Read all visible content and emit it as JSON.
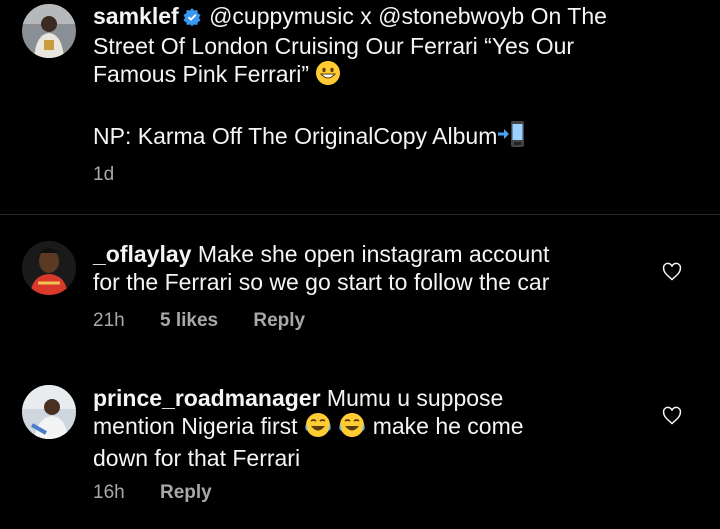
{
  "post": {
    "username": "samklef",
    "caption_line1": "@cuppymusic x @stonebwoyb On The",
    "caption_line2": "Street Of London Cruising Our Ferrari “Yes Our",
    "caption_line3": "Famous Pink Ferrari”",
    "caption_line4": "NP: Karma Off The OriginalCopy Album",
    "time": "1d",
    "emoji_1": "grin-emoji",
    "emoji_2": "phone-arrow-emoji"
  },
  "comments": [
    {
      "username": "_oflaylay",
      "line1": "Make she open instagram account",
      "line2": "for the Ferrari so we go start to follow the car",
      "time": "21h",
      "likes": "5 likes",
      "reply": "Reply"
    },
    {
      "username": "prince_roadmanager",
      "line1": "Mumu u suppose",
      "line2a": "mention Nigeria first",
      "line2b": "make he come",
      "line3": "down for that Ferrari",
      "time": "16h",
      "reply": "Reply"
    }
  ],
  "colors": {
    "background": "#000000",
    "text": "#f5f5f5",
    "muted": "#a8a8a8",
    "verified": "#3897f0"
  }
}
